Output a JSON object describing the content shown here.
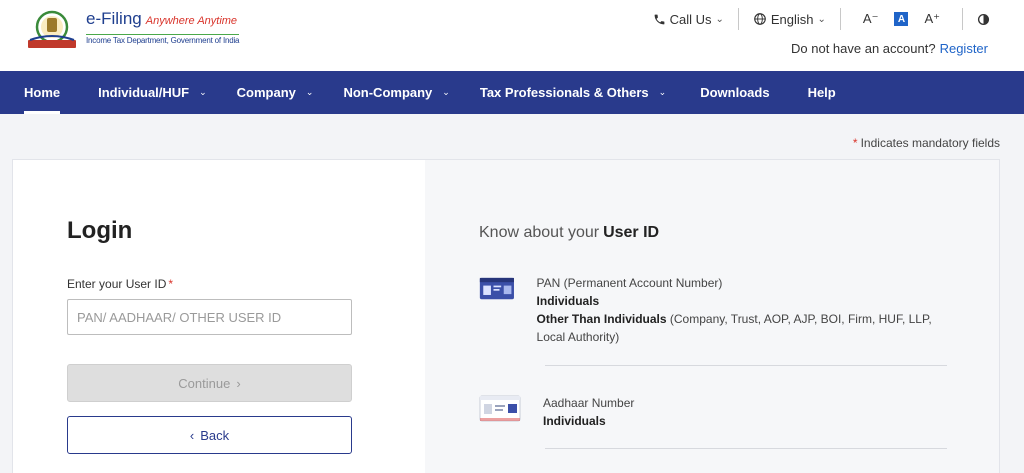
{
  "header": {
    "logo_title": "e-Filing",
    "logo_tagline": "Anywhere Anytime",
    "logo_subtitle": "Income Tax Department, Government of India",
    "call_us": "Call Us",
    "language": "English",
    "font_decrease": "A⁻",
    "font_normal": "A",
    "font_increase": "A⁺",
    "no_account_text": "Do not have an account?",
    "register": "Register"
  },
  "nav": {
    "items": [
      {
        "label": "Home",
        "active": true,
        "dropdown": false
      },
      {
        "label": "Individual/HUF",
        "active": false,
        "dropdown": true
      },
      {
        "label": "Company",
        "active": false,
        "dropdown": true
      },
      {
        "label": "Non-Company",
        "active": false,
        "dropdown": true
      },
      {
        "label": "Tax Professionals & Others",
        "active": false,
        "dropdown": true
      },
      {
        "label": "Downloads",
        "active": false,
        "dropdown": false
      },
      {
        "label": "Help",
        "active": false,
        "dropdown": false
      }
    ]
  },
  "mandatory_note": "Indicates mandatory fields",
  "login": {
    "title": "Login",
    "user_id_label": "Enter your User ID",
    "user_id_placeholder": "PAN/ AADHAAR/ OTHER USER ID",
    "continue": "Continue",
    "back": "Back"
  },
  "know": {
    "prefix": "Know about your",
    "highlight": "User ID",
    "pan": {
      "title": "PAN (Permanent Account Number)",
      "line1": "Individuals",
      "line2_bold": "Other Than Individuals",
      "line2_rest": "(Company, Trust, AOP, AJP, BOI, Firm, HUF, LLP, Local Authority)"
    },
    "aadhaar": {
      "title": "Aadhaar Number",
      "line1": "Individuals"
    }
  },
  "colors": {
    "nav_bg": "#293a8c",
    "link": "#1f64c8",
    "required": "#d9342b"
  }
}
